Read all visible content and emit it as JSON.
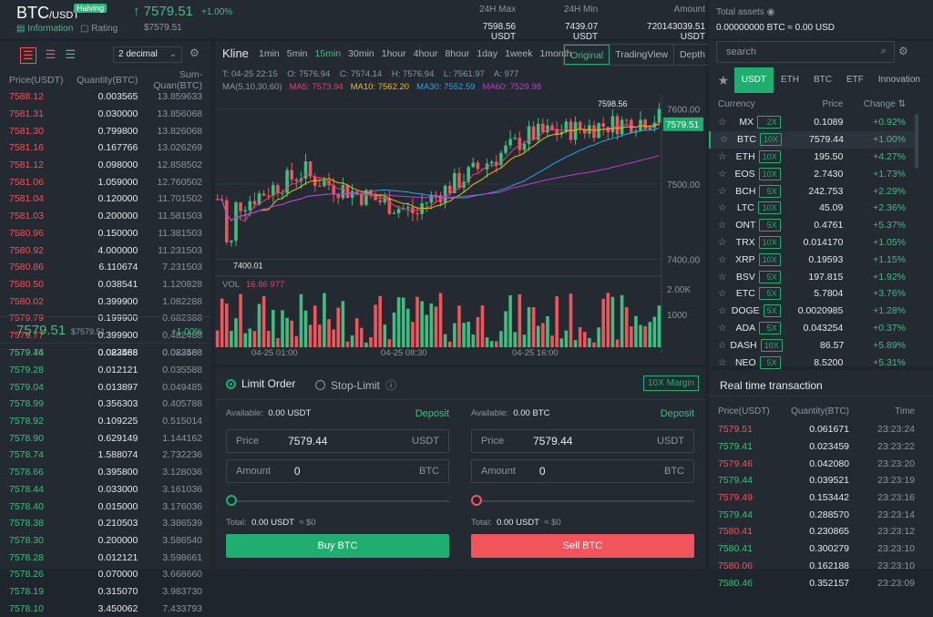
{
  "header": {
    "pair": "BTC",
    "quote": "/USDT",
    "halving": "Halving",
    "info": "Information",
    "rating": "Rating",
    "last_price": "7579.51",
    "last_change": "+1.00%",
    "last_usd": "$7579.51",
    "stats": [
      {
        "label": "24H Max",
        "value": "7598.56 USDT"
      },
      {
        "label": "24H Min",
        "value": "7439.07 USDT"
      },
      {
        "label": "Amount",
        "value": "720143039.51 USDT"
      }
    ],
    "assets_label": "Total assets",
    "assets_value": "0.00000000 BTC ≈ 0.00 USD"
  },
  "orderbook": {
    "decimal": "2 decimal",
    "headers": [
      "Price(USDT)",
      "Quantity(BTC)",
      "Sum-Quan(BTC)"
    ],
    "asks": [
      [
        "7588.12",
        "0.003565",
        "13.859633"
      ],
      [
        "7581.31",
        "0.030000",
        "13.856068"
      ],
      [
        "7581.30",
        "0.799800",
        "13.826068"
      ],
      [
        "7581.16",
        "0.167766",
        "13.026269"
      ],
      [
        "7581.12",
        "0.098000",
        "12.858502"
      ],
      [
        "7581.06",
        "1.059000",
        "12.760502"
      ],
      [
        "7581.04",
        "0.120000",
        "11.701502"
      ],
      [
        "7581.03",
        "0.200000",
        "11.581503"
      ],
      [
        "7580.96",
        "0.150000",
        "11.381503"
      ],
      [
        "7580.92",
        "4.000000",
        "11.231503"
      ],
      [
        "7580.86",
        "6.110674",
        "7.231503"
      ],
      [
        "7580.50",
        "0.038541",
        "1.120828"
      ],
      [
        "7580.02",
        "0.399900",
        "1.082288"
      ],
      [
        "7579.79",
        "0.199900",
        "0.682388"
      ],
      [
        "7579.77",
        "0.399900",
        "0.482488"
      ],
      [
        "7579.76",
        "0.082588",
        "0.082588"
      ]
    ],
    "mid_price": "7579.51",
    "mid_usd": "$7579.51",
    "mid_change": "+1.00%",
    "bids": [
      [
        "7579.44",
        "0.023468",
        "0.023468"
      ],
      [
        "7579.28",
        "0.012121",
        "0.035588"
      ],
      [
        "7579.04",
        "0.013897",
        "0.049485"
      ],
      [
        "7578.99",
        "0.356303",
        "0.405788"
      ],
      [
        "7578.92",
        "0.109225",
        "0.515014"
      ],
      [
        "7578.90",
        "0.629149",
        "1.144162"
      ],
      [
        "7578.74",
        "1.588074",
        "2.732236"
      ],
      [
        "7578.66",
        "0.395800",
        "3.128036"
      ],
      [
        "7578.44",
        "0.033000",
        "3.161036"
      ],
      [
        "7578.40",
        "0.015000",
        "3.176036"
      ],
      [
        "7578.38",
        "0.210503",
        "3.386539"
      ],
      [
        "7578.30",
        "0.200000",
        "3.586540"
      ],
      [
        "7578.28",
        "0.012121",
        "3.598661"
      ],
      [
        "7578.26",
        "0.070000",
        "3.668660"
      ],
      [
        "7578.19",
        "0.315070",
        "3.983730"
      ],
      [
        "7578.10",
        "3.450062",
        "7.433793"
      ]
    ]
  },
  "kline": {
    "title": "Kline",
    "intervals": [
      "1min",
      "5min",
      "15min",
      "30min",
      "1hour",
      "4hour",
      "8hour",
      "1day",
      "1week",
      "1month"
    ],
    "active_interval": "15min",
    "views": [
      "Original",
      "TradingView",
      "Depth"
    ],
    "ohlc": "T: 04-25 22:15    O: 7576.94    C: 7574.14    H: 7576.94    L: 7561.97    A: 977",
    "ma_label": "MA(5,10,30,60)",
    "ma5": "MA5: 7573.94",
    "ma10": "MA10: 7562.20",
    "ma30": "MA30: 7552.59",
    "ma60": "MA60: 7529.98",
    "price_ticks": [
      "7600.00",
      "7500.00",
      "7400.00"
    ],
    "vol_ticks": [
      "2.00K",
      "1000"
    ],
    "time_ticks": [
      "04-25 01:00",
      "04-25 08:30",
      "04-25 16:00"
    ],
    "high_mark": "7598.56",
    "low_mark": "7400.01",
    "current": "7579.51",
    "vol_label": "VOL",
    "vol_value": "16.86 977"
  },
  "order": {
    "limit": "Limit Order",
    "stop": "Stop-Limit",
    "margin": "10X Margin",
    "buy": {
      "available": "Available:",
      "avail_value": "0.00 USDT",
      "deposit": "Deposit",
      "price_label": "Price",
      "price": "7579.44",
      "price_unit": "USDT",
      "amount_label": "Amount",
      "amount": "0",
      "amount_unit": "BTC",
      "total_label": "Total:",
      "total": "0.00 USDT",
      "total_usd": "≈ $0",
      "button": "Buy BTC"
    },
    "sell": {
      "available": "Available:",
      "avail_value": "0.00 BTC",
      "deposit": "Deposit",
      "price_label": "Price",
      "price": "7579.44",
      "price_unit": "USDT",
      "amount_label": "Amount",
      "amount": "0",
      "amount_unit": "BTC",
      "total_label": "Total:",
      "total": "0.00 USDT",
      "total_usd": "≈ $0",
      "button": "Sell BTC"
    }
  },
  "market": {
    "search_placeholder": "search",
    "tabs": [
      "USDT",
      "ETH",
      "BTC",
      "ETF",
      "Innovation"
    ],
    "headers": [
      "Currency",
      "Price",
      "Change"
    ],
    "rows": [
      [
        "MX",
        "2X",
        "0.1089",
        "+0.92%"
      ],
      [
        "BTC",
        "10X",
        "7579.44",
        "+1.00%"
      ],
      [
        "ETH",
        "10X",
        "195.50",
        "+4.27%"
      ],
      [
        "EOS",
        "10X",
        "2.7430",
        "+1.73%"
      ],
      [
        "BCH",
        "5X",
        "242.753",
        "+2.29%"
      ],
      [
        "LTC",
        "10X",
        "45.09",
        "+2.36%"
      ],
      [
        "ONT",
        "5X",
        "0.4761",
        "+5.37%"
      ],
      [
        "TRX",
        "10X",
        "0.014170",
        "+1.05%"
      ],
      [
        "XRP",
        "10X",
        "0.19593",
        "+1.15%"
      ],
      [
        "BSV",
        "5X",
        "197.815",
        "+1.92%"
      ],
      [
        "ETC",
        "5X",
        "5.7804",
        "+3.76%"
      ],
      [
        "DOGE",
        "5X",
        "0.0020985",
        "+1.28%"
      ],
      [
        "ADA",
        "5X",
        "0.043254",
        "+0.37%"
      ],
      [
        "DASH",
        "10X",
        "86.57",
        "+5.89%"
      ],
      [
        "NEO",
        "5X",
        "8.5200",
        "+5.31%"
      ]
    ]
  },
  "trades": {
    "title": "Real time transaction",
    "headers": [
      "Price(USDT)",
      "Quantity(BTC)",
      "Time"
    ],
    "rows": [
      [
        "7579.51",
        "0.061671",
        "23:23:24",
        "r"
      ],
      [
        "7579.41",
        "0.023459",
        "23:23:22",
        "g"
      ],
      [
        "7579.46",
        "0.042080",
        "23:23:20",
        "r"
      ],
      [
        "7579.44",
        "0.039521",
        "23:23:19",
        "g"
      ],
      [
        "7579.49",
        "0.153442",
        "23:23:16",
        "r"
      ],
      [
        "7579.44",
        "0.288570",
        "23:23:14",
        "g"
      ],
      [
        "7580.41",
        "0.230865",
        "23:23:12",
        "r"
      ],
      [
        "7580.41",
        "0.300279",
        "23:23:10",
        "g"
      ],
      [
        "7580.06",
        "0.162188",
        "23:23:10",
        "r"
      ],
      [
        "7580.46",
        "0.352157",
        "23:23:09",
        "g"
      ]
    ]
  }
}
